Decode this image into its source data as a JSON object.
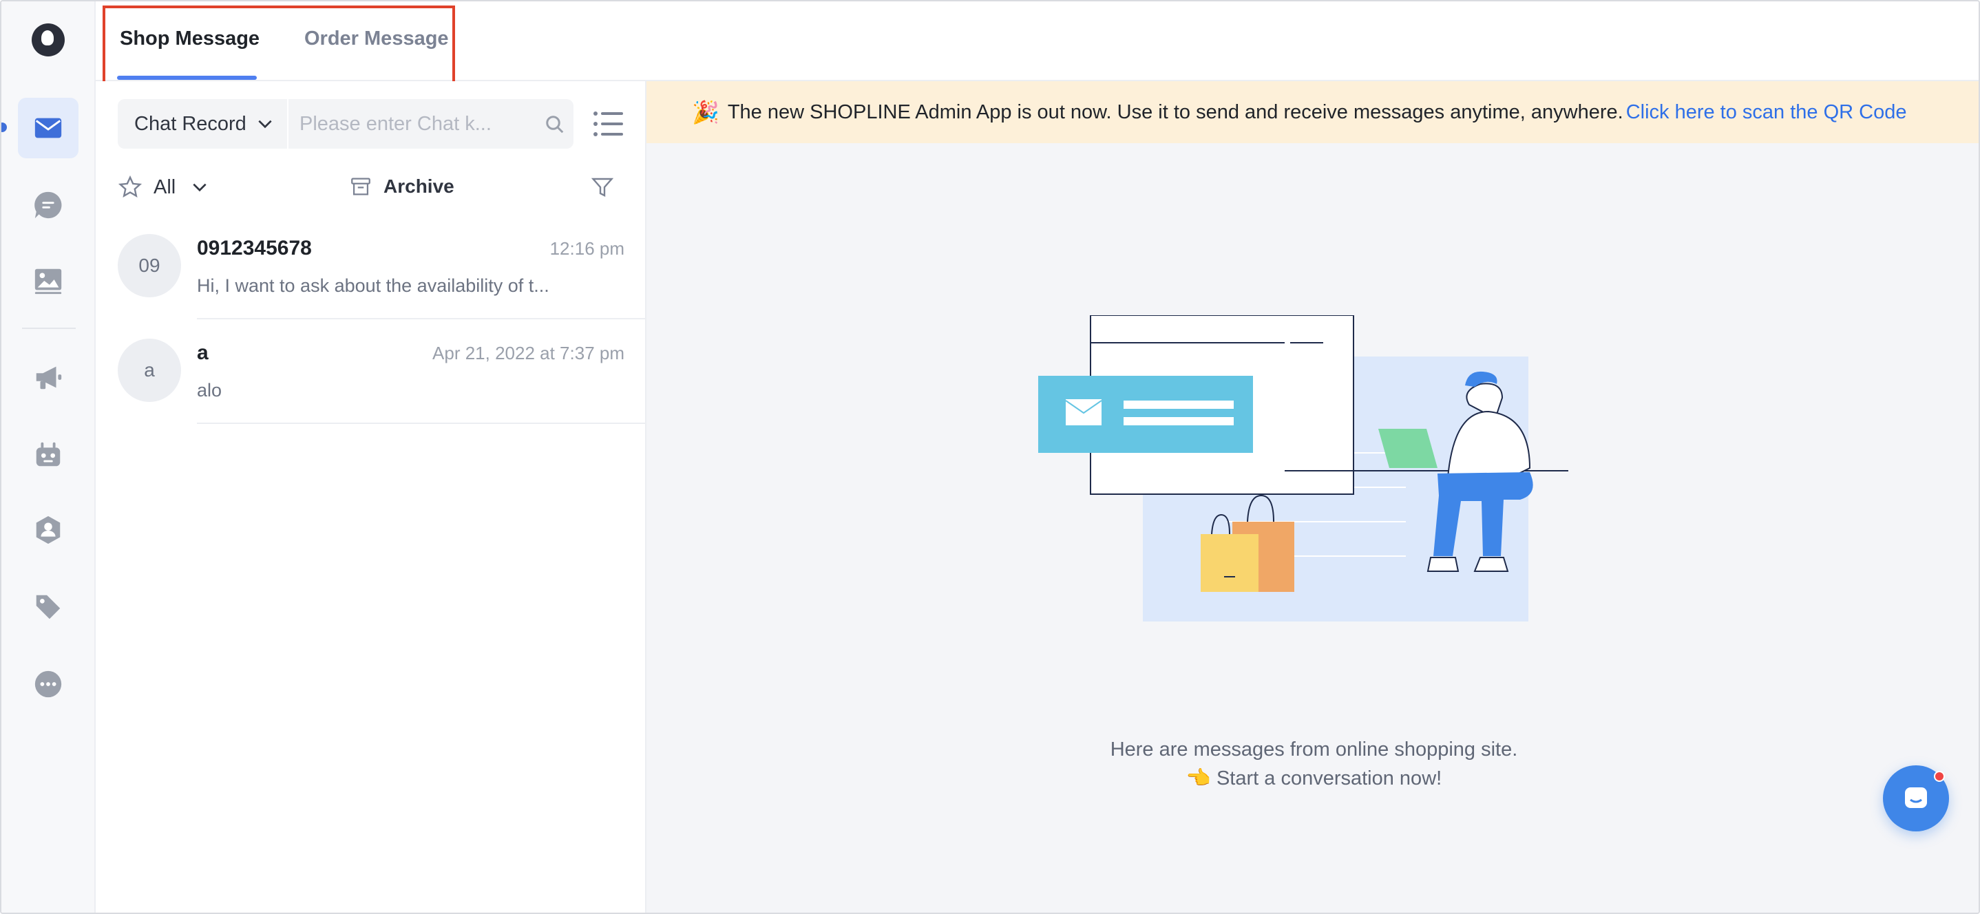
{
  "tabs": {
    "shop_message": "Shop Message",
    "order_message": "Order Message",
    "active": "Shop Message"
  },
  "sidebar": {
    "items": [
      {
        "icon": "mail-icon",
        "active": true
      },
      {
        "icon": "chat-bubble-icon",
        "active": false
      },
      {
        "icon": "image-icon",
        "active": false
      },
      {
        "icon": "megaphone-icon",
        "active": false
      },
      {
        "icon": "robot-icon",
        "active": false
      },
      {
        "icon": "customer-icon",
        "active": false
      },
      {
        "icon": "tag-icon",
        "active": false
      },
      {
        "icon": "more-icon",
        "active": false
      }
    ]
  },
  "search": {
    "type_selected": "Chat Record",
    "placeholder": "Please enter Chat k..."
  },
  "filters": {
    "star_filter": "All",
    "archive_label": "Archive"
  },
  "conversations": [
    {
      "avatar": "09",
      "name": "0912345678",
      "time": "12:16 pm",
      "preview": "Hi, I want to ask about the availability of t..."
    },
    {
      "avatar": "a",
      "name": "a",
      "time": "Apr 21, 2022 at 7:37 pm",
      "preview": "alo"
    }
  ],
  "banner": {
    "emoji": "🎉",
    "text": "The new SHOPLINE Admin App is out now. Use it to send and receive messages anytime, anywhere.",
    "link": "Click here to scan the QR Code"
  },
  "empty_state": {
    "line1": "Here are messages from online shopping site.",
    "line2": "👈 Start a conversation now!"
  },
  "colors": {
    "accent": "#4f7ff0",
    "highlight_box": "#e0422b",
    "banner_bg": "#fdf0d9",
    "link": "#2e6fe8"
  }
}
